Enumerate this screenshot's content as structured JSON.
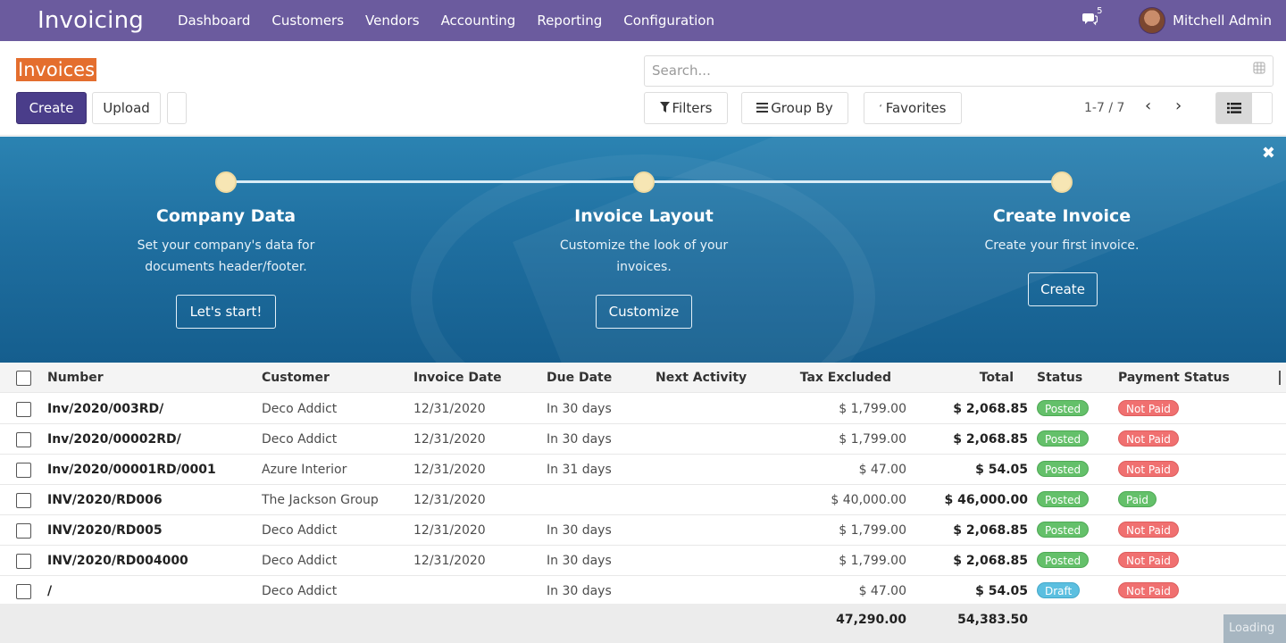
{
  "navbar": {
    "app_title": "Invoicing",
    "menu": [
      "Dashboard",
      "Customers",
      "Vendors",
      "Accounting",
      "Reporting",
      "Configuration"
    ],
    "chat_count": "5",
    "user_name": "Mitchell Admin"
  },
  "control": {
    "title": "Invoices",
    "create_label": "Create",
    "upload_label": "Upload",
    "search_placeholder": "Search...",
    "filters_label": "Filters",
    "group_by_label": "Group By",
    "favorites_label": "Favorites",
    "pager_text": "1-7 / 7"
  },
  "banner": {
    "steps": [
      {
        "title": "Company Data",
        "desc1": "Set your company's data for",
        "desc2": "documents header/footer.",
        "button": "Let's start!"
      },
      {
        "title": "Invoice Layout",
        "desc1": "Customize the look of your",
        "desc2": "invoices.",
        "button": "Customize"
      },
      {
        "title": "Create Invoice",
        "desc1": "Create your first invoice.",
        "desc2": "",
        "button": "Create"
      }
    ]
  },
  "table": {
    "headers": [
      "Number",
      "Customer",
      "Invoice Date",
      "Due Date",
      "Next Activity",
      "Tax Excluded",
      "Total",
      "Status",
      "Payment Status"
    ],
    "rows": [
      {
        "number": "Inv/2020/003RD/",
        "customer": "Deco Addict",
        "invoice_date": "12/31/2020",
        "due": "In 30 days",
        "tax_excl": "$ 1,799.00",
        "total": "$ 2,068.85",
        "status": "Posted",
        "payment": "Not Paid"
      },
      {
        "number": "Inv/2020/00002RD/",
        "customer": "Deco Addict",
        "invoice_date": "12/31/2020",
        "due": "In 30 days",
        "tax_excl": "$ 1,799.00",
        "total": "$ 2,068.85",
        "status": "Posted",
        "payment": "Not Paid"
      },
      {
        "number": "Inv/2020/00001RD/0001",
        "customer": "Azure Interior",
        "invoice_date": "12/31/2020",
        "due": "In 31 days",
        "tax_excl": "$ 47.00",
        "total": "$ 54.05",
        "status": "Posted",
        "payment": "Not Paid"
      },
      {
        "number": "INV/2020/RD006",
        "customer": "The Jackson Group",
        "invoice_date": "12/31/2020",
        "due": "",
        "tax_excl": "$ 40,000.00",
        "total": "$ 46,000.00",
        "status": "Posted",
        "payment": "Paid"
      },
      {
        "number": "INV/2020/RD005",
        "customer": "Deco Addict",
        "invoice_date": "12/31/2020",
        "due": "In 30 days",
        "tax_excl": "$ 1,799.00",
        "total": "$ 2,068.85",
        "status": "Posted",
        "payment": "Not Paid"
      },
      {
        "number": "INV/2020/RD004000",
        "customer": "Deco Addict",
        "invoice_date": "12/31/2020",
        "due": "In 30 days",
        "tax_excl": "$ 1,799.00",
        "total": "$ 2,068.85",
        "status": "Posted",
        "payment": "Not Paid"
      },
      {
        "number": "/",
        "customer": "Deco Addict",
        "invoice_date": "",
        "due": "In 30 days",
        "tax_excl": "$ 47.00",
        "total": "$ 54.05",
        "status": "Draft",
        "payment": "Not Paid"
      }
    ],
    "footer_tax_excl": "47,290.00",
    "footer_total": "54,383.50"
  },
  "loading_text": "Loading",
  "colors": {
    "navbar": "#6b5b9e",
    "primary": "#4a3d8a",
    "banner": "#1f6fa0",
    "posted": "#64c06a",
    "not_paid": "#f07070",
    "draft": "#5bbfe0"
  }
}
